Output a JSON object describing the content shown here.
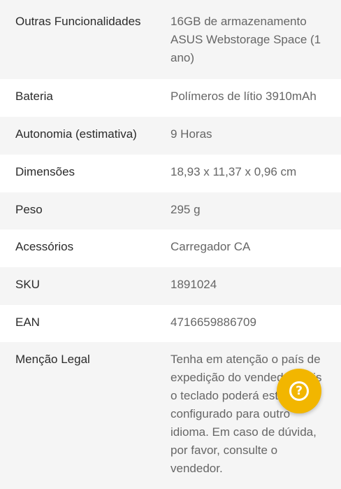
{
  "specs": [
    {
      "label": "Outras Funcionalidades",
      "value": "16GB de armazenamento ASUS Webstorage Space (1 ano)"
    },
    {
      "label": "Bateria",
      "value": "Polímeros de lítio 3910mAh"
    },
    {
      "label": "Autonomia (estimativa)",
      "value": "9 Horas"
    },
    {
      "label": "Dimensões",
      "value": "18,93 x 11,37 x 0,96 cm"
    },
    {
      "label": "Peso",
      "value": "295 g"
    },
    {
      "label": "Acessórios",
      "value": "Carregador CA"
    },
    {
      "label": "SKU",
      "value": "1891024"
    },
    {
      "label": "EAN",
      "value": "4716659886709"
    },
    {
      "label": "Menção Legal",
      "value": "Tenha em atenção o país de expedição do vendedor, pois o teclado poderá estar configurado para outro idioma. Em caso de dúvida, por favor, consulte o vendedor."
    }
  ],
  "help_button": {
    "icon": "question-circle-icon",
    "color": "#f2b600",
    "glyph": "?"
  }
}
